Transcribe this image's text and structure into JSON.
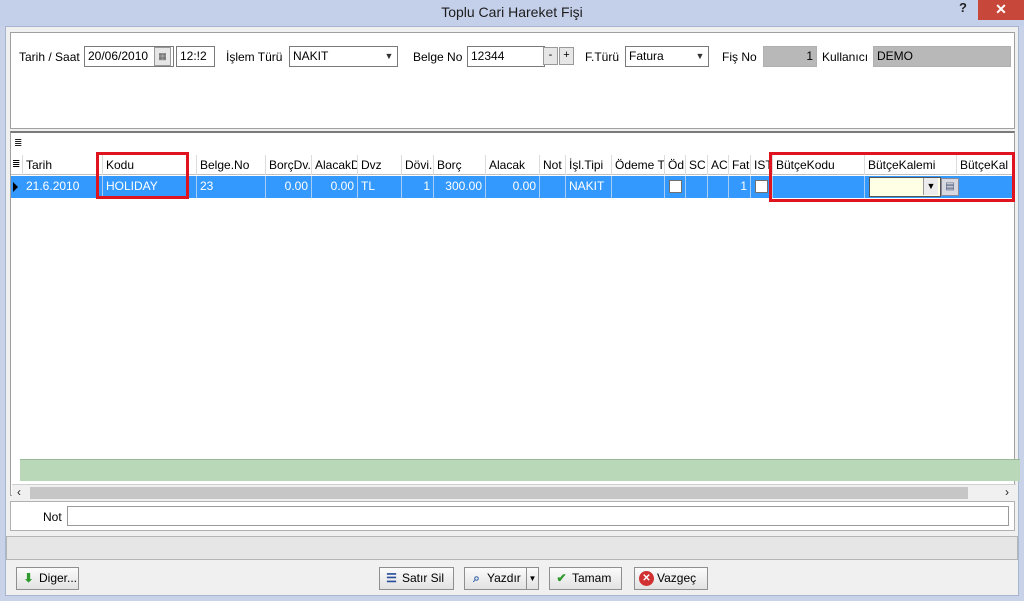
{
  "window": {
    "title": "Toplu Cari Hareket Fişi",
    "help": "?",
    "close": "✕"
  },
  "header": {
    "tarih_label": "Tarih / Saat",
    "tarih_value": "20/06/2010",
    "saat_value": "12:!2",
    "islem_turu_label": "İşlem Türü",
    "islem_turu_value": "NAKIT",
    "belge_no_label": "Belge No",
    "belge_no_value": "12344",
    "minus": "-",
    "plus": "+",
    "fturu_label": "F.Türü",
    "fturu_value": "Fatura",
    "fis_no_label": "Fiş No",
    "fis_no_value": "1",
    "kullanici_label": "Kullanıcı",
    "kullanici_value": "DEMO"
  },
  "grid": {
    "columns": [
      "Tarih",
      "Kodu",
      "Belge.No",
      "BorçDv.",
      "AlacakD",
      "Dvz",
      "Dövi.",
      "Borç",
      "Alacak",
      "Not",
      "İşl.Tipi",
      "Ödeme T",
      "Öd",
      "SC",
      "AC",
      "Fat",
      "IST",
      "BütçeKodu",
      "BütçeKalemi",
      "BütçeKal"
    ],
    "row": {
      "tarih": "21.6.2010",
      "kodu": "HOLIDAY",
      "belge_no": "23",
      "borc_dv": "0.00",
      "alacak_dv": "0.00",
      "dvz": "TL",
      "dovi": "1",
      "borc": "300.00",
      "alacak": "0.00",
      "not": "",
      "isl_tipi": "NAKIT",
      "odeme_t": "",
      "fat": "1"
    }
  },
  "note": {
    "label": "Not",
    "value": ""
  },
  "buttons": {
    "diger": "Diger...",
    "satir_sil": "Satır Sil",
    "yazdir": "Yazdır",
    "tamam": "Tamam",
    "vazgec": "Vazgeç"
  },
  "colors": {
    "selection": "#3399ff",
    "highlight_box": "#e0141e",
    "close_button": "#c7483b",
    "totals_strip": "#b8d8b8"
  }
}
